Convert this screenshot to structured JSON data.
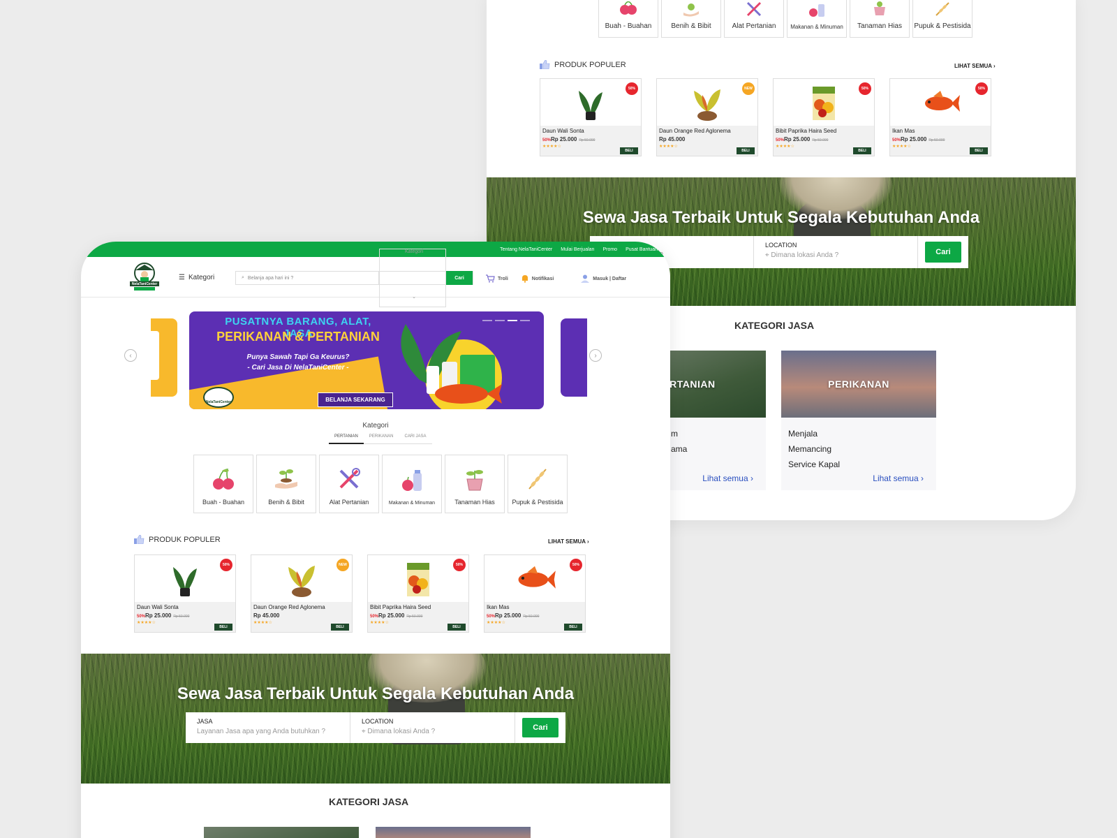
{
  "categories": [
    {
      "label": "Buah - Buahan",
      "icon": "cherry-icon"
    },
    {
      "label": "Benih & Bibit",
      "icon": "seedling-hand-icon"
    },
    {
      "label": "Alat Pertanian",
      "icon": "tools-icon"
    },
    {
      "label": "Makanan & Minuman",
      "icon": "food-bottle-icon"
    },
    {
      "label": "Tanaman Hias",
      "icon": "potted-plant-icon"
    },
    {
      "label": "Pupuk & Pestisida",
      "icon": "wheat-icon"
    }
  ],
  "popular": {
    "title": "PRODUK POPULER",
    "see_all": "LIHAT SEMUA",
    "buy_label": "BELI",
    "products": [
      {
        "name": "Daun Wali Sonta",
        "discount": "50%",
        "price": "Rp 25.000",
        "old_price": "Rp 50.000",
        "badge": "50%",
        "badge_color": "#e6262e",
        "stars": "★★★★☆"
      },
      {
        "name": "Daun Orange Red Aglonema",
        "discount": "",
        "price": "Rp 45.000",
        "old_price": "",
        "badge": "NEW",
        "badge_color": "#f5a623",
        "stars": "★★★★☆"
      },
      {
        "name": "Bibit Paprika Haira Seed",
        "discount": "50%",
        "price": "Rp 25.000",
        "old_price": "Rp 50.000",
        "badge": "50%",
        "badge_color": "#e6262e",
        "stars": "★★★★☆"
      },
      {
        "name": "Ikan Mas",
        "discount": "50%",
        "price": "Rp 25.000",
        "old_price": "Rp 50.000",
        "badge": "50%",
        "badge_color": "#e6262e",
        "stars": "★★★★☆"
      }
    ]
  },
  "hero": {
    "title": "Sewa Jasa Terbaik Untuk Segala Kebutuhan Anda",
    "jasa_label": "JASA",
    "jasa_placeholder": "Layanan Jasa apa yang Anda butuhkan ?",
    "back_jasa_placeholder": "ng Anda butuhkan ?",
    "location_label": "LOCATION",
    "location_placeholder": "Dimana lokasi Anda ?",
    "search_button": "Cari"
  },
  "kategori_jasa": {
    "title": "KATEGORI JASA",
    "cards": [
      {
        "title": "ERTANIAN",
        "items": [
          "m",
          "ama"
        ],
        "more": "Lihat semua"
      },
      {
        "title": "PERIKANAN",
        "items": [
          "Menjala",
          "Memancing",
          "Service Kapal"
        ],
        "more": "Lihat semua"
      }
    ]
  },
  "topbar": {
    "links": [
      "Tentang NelaTaniCenter",
      "Mulai Berjualan",
      "Promo",
      "Pusat Bantuan"
    ]
  },
  "navbar": {
    "logo_text": "NelaTaniCenter",
    "kategori": "Kategori",
    "search_placeholder": "Belanja apa hari ini ?",
    "category_select": "Kategori",
    "search_button": "Cari",
    "cart": "Troli",
    "notif": "Notifikasi",
    "login": "Masuk | Daftar"
  },
  "banner": {
    "line1": "PUSATNYA BARANG, ALAT, JASA",
    "line2": "PERIKANAN & PERTANIAN",
    "line3": "Punya Sawah Tapi Ga Keurus?",
    "line4": "- Cari Jasa Di NelaTaniCenter -",
    "cta": "BELANJA SEKARANG",
    "logo_text": "NelaTaniCenter"
  },
  "kategori_section": {
    "title": "Kategori",
    "tabs": [
      "PERTANIAN",
      "PERIKANAN",
      "CARI JASA"
    ],
    "active_tab": "PERTANIAN"
  },
  "colors": {
    "brand_green": "#0da845",
    "banner_purple": "#5c2fb3",
    "banner_yellow": "#f8b92c",
    "buy_dark": "#1f4a2c",
    "link_blue": "#2a4fbf"
  }
}
